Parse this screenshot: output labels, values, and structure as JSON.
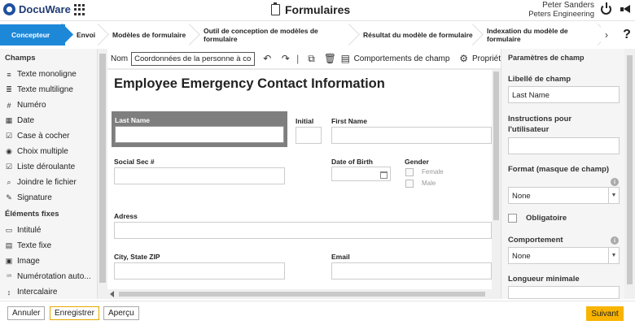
{
  "header": {
    "logo_text": "DocuWare",
    "app_title": "Formulaires",
    "user_name": "Peter Sanders",
    "user_org": "Peters Engineering"
  },
  "steps": {
    "items": [
      "Concepteur",
      "Envoi",
      "Modèles de formulaire",
      "Outil de conception de modèles de formulaire",
      "Résultat du modèle de formulaire",
      "Indexation du modèle de formulaire"
    ],
    "more_label": "›",
    "help_label": "?"
  },
  "left_panel": {
    "fields_heading": "Champs",
    "fields": [
      {
        "label": "Texte monoligne",
        "icon": "text-single-icon",
        "glyph": "≡"
      },
      {
        "label": "Texte multiligne",
        "icon": "text-multi-icon",
        "glyph": "≣"
      },
      {
        "label": "Numéro",
        "icon": "number-icon",
        "glyph": "#"
      },
      {
        "label": "Date",
        "icon": "calendar-icon",
        "glyph": "▦"
      },
      {
        "label": "Case à cocher",
        "icon": "checkbox-icon",
        "glyph": "☑"
      },
      {
        "label": "Choix multiple",
        "icon": "radio-icon",
        "glyph": "◉"
      },
      {
        "label": "Liste déroulante",
        "icon": "dropdown-icon",
        "glyph": "☑"
      },
      {
        "label": "Joindre le fichier",
        "icon": "paperclip-icon",
        "glyph": "⌕"
      },
      {
        "label": "Signature",
        "icon": "signature-icon",
        "glyph": "✎"
      }
    ],
    "fixed_heading": "Éléments fixes",
    "fixed": [
      {
        "label": "Intitulé",
        "icon": "heading-icon",
        "glyph": "▭"
      },
      {
        "label": "Texte fixe",
        "icon": "fixed-text-icon",
        "glyph": "▤"
      },
      {
        "label": "Image",
        "icon": "image-icon",
        "glyph": "▣"
      },
      {
        "label": "Numérotation auto...",
        "icon": "autonumber-icon",
        "glyph": "¹²³"
      },
      {
        "label": "Intercalaire",
        "icon": "separator-icon",
        "glyph": "↕"
      }
    ]
  },
  "toolbar": {
    "nom_label": "Nom",
    "nom_value": "Coordonnées de la personne à contact",
    "behaviors_label": "Comportements de champ",
    "properties_label": "Propriét"
  },
  "form": {
    "title": "Employee Emergency Contact Information",
    "labels": {
      "last_name": "Last Name",
      "initial": "Initial",
      "first_name": "First Name",
      "social_sec": "Social Sec #",
      "date_of_birth": "Date of Birth",
      "gender": "Gender",
      "female": "Female",
      "male": "Male",
      "address": "Adress",
      "city_state_zip": "City, State ZIP",
      "email": "Email"
    }
  },
  "right_panel": {
    "title": "Paramètres de champ",
    "field_label_heading": "Libellé de champ",
    "field_label_value": "Last Name",
    "instructions_heading": "Instructions pour l'utilisateur",
    "instructions_value": "",
    "format_heading": "Format (masque de champ)",
    "format_value": "None",
    "required_label": "Obligatoire",
    "behavior_heading": "Comportement",
    "behavior_value": "None",
    "min_length_heading": "Longueur minimale"
  },
  "footer": {
    "cancel_label": "Annuler",
    "save_label": "Enregistrer",
    "preview_label": "Aperçu",
    "next_label": "Suivant"
  },
  "colors": {
    "accent": "#1e88d8",
    "primary_button": "#f8b400"
  }
}
